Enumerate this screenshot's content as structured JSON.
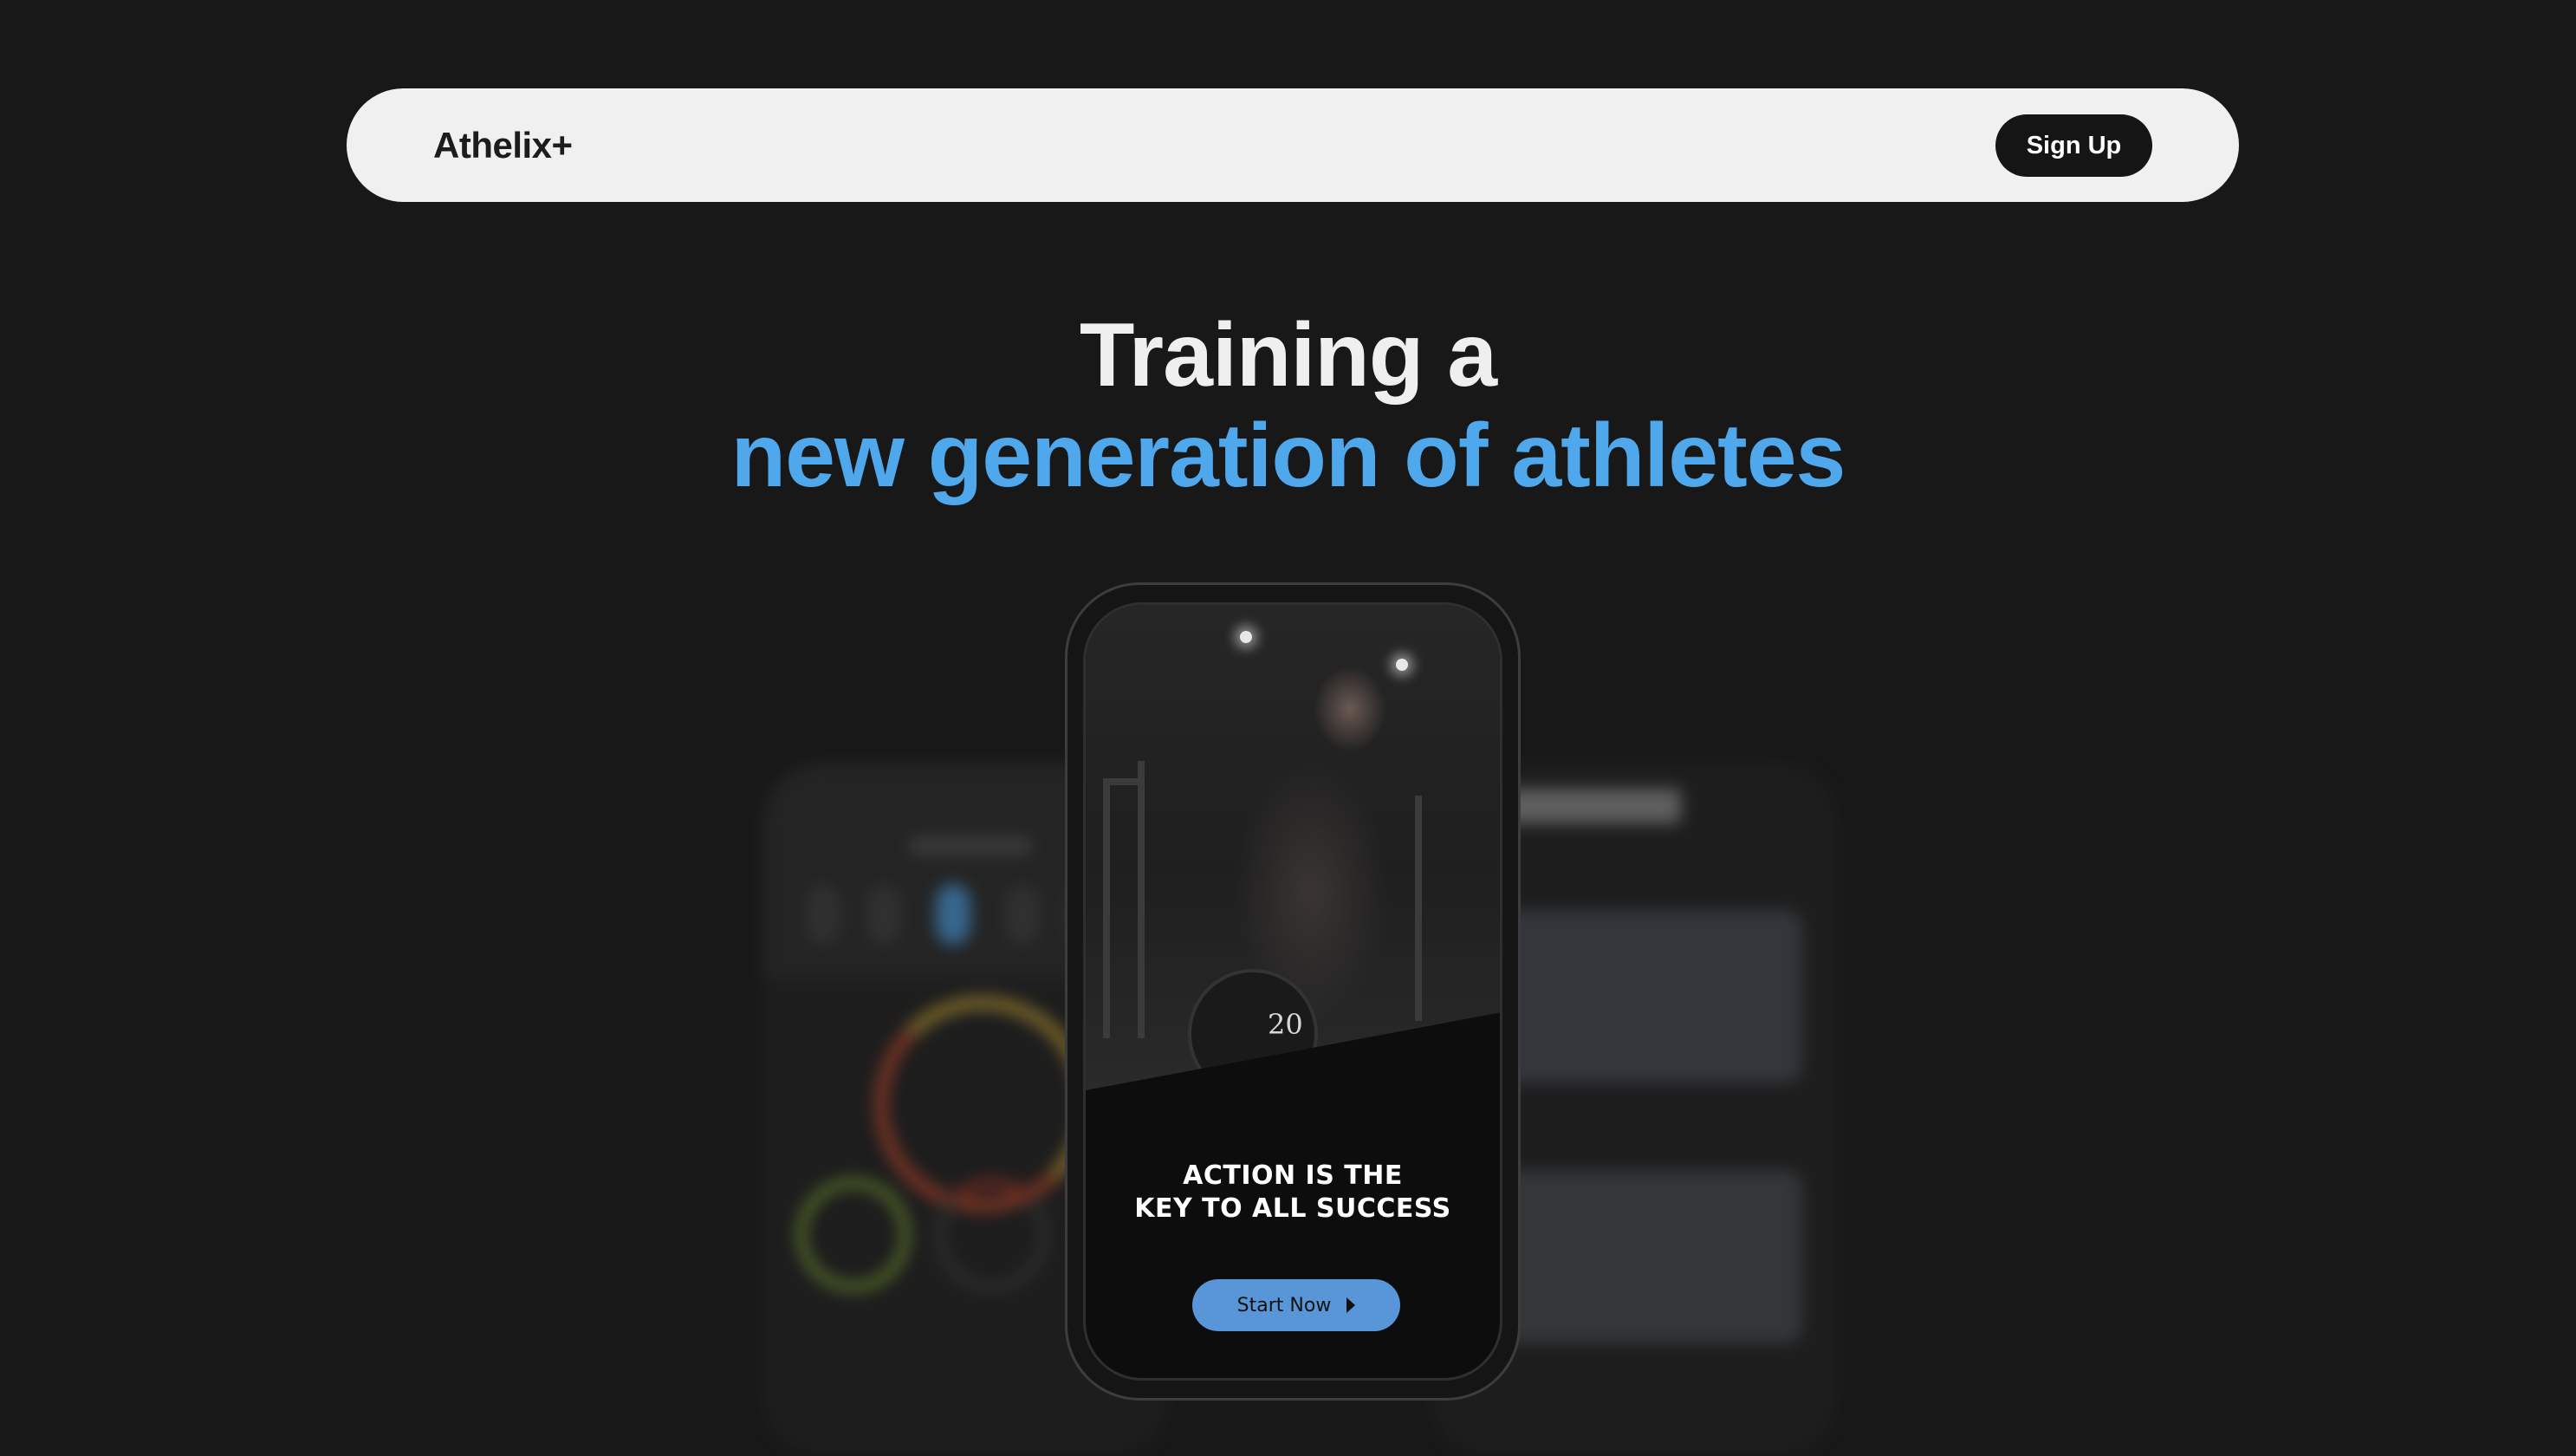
{
  "nav": {
    "logo": "Athelix+",
    "signup_label": "Sign Up"
  },
  "hero": {
    "line1": "Training a",
    "line2": "new generation of athletes"
  },
  "phone": {
    "plate_number": "20",
    "tagline_line1": "ACTION IS THE",
    "tagline_line2": "KEY TO ALL SUCCESS",
    "cta_label": "Start Now",
    "cta_icon": "play-icon"
  },
  "colors": {
    "background": "#181818",
    "nav_bg": "#f0f0f0",
    "accent": "#4fa8ec",
    "cta": "#5896d8"
  }
}
